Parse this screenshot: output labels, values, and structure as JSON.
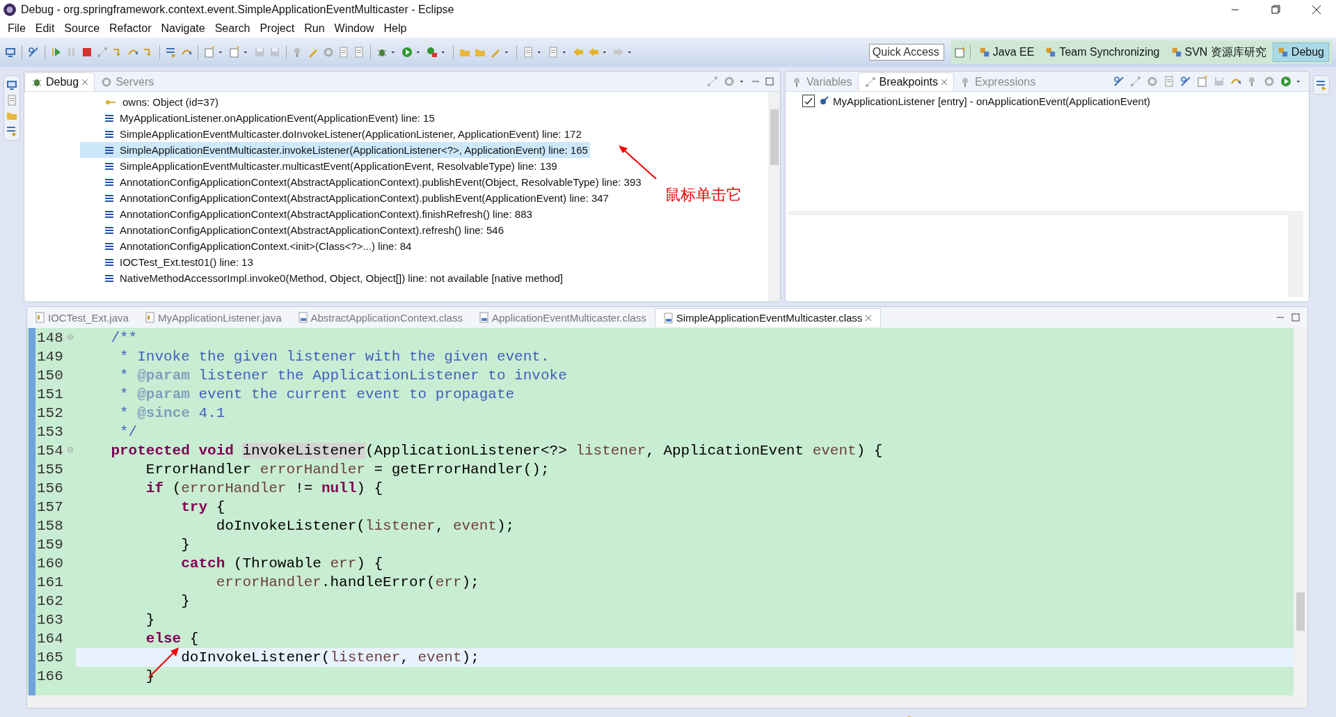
{
  "window": {
    "title": "Debug - org.springframework.context.event.SimpleApplicationEventMulticaster - Eclipse"
  },
  "menu": [
    "File",
    "Edit",
    "Source",
    "Refactor",
    "Navigate",
    "Search",
    "Project",
    "Run",
    "Window",
    "Help"
  ],
  "quick_access": {
    "placeholder": "Quick Access"
  },
  "perspectives": [
    {
      "label": "Java EE",
      "selected": false
    },
    {
      "label": "Team Synchronizing",
      "selected": false
    },
    {
      "label": "SVN 资源库研究",
      "selected": false
    },
    {
      "label": "Debug",
      "selected": true
    }
  ],
  "debug_view": {
    "tabs": [
      {
        "label": "Debug",
        "selected": true
      },
      {
        "label": "Servers",
        "selected": false
      }
    ],
    "frames": [
      {
        "kind": "variable",
        "text": "owns: Object  (id=37)",
        "selected": false
      },
      {
        "kind": "frame",
        "text": "MyApplicationListener.onApplicationEvent(ApplicationEvent) line: 15",
        "selected": false
      },
      {
        "kind": "frame",
        "text": "SimpleApplicationEventMulticaster.doInvokeListener(ApplicationListener, ApplicationEvent) line: 172",
        "selected": false
      },
      {
        "kind": "frame",
        "text": "SimpleApplicationEventMulticaster.invokeListener(ApplicationListener<?>, ApplicationEvent) line: 165",
        "selected": true
      },
      {
        "kind": "frame",
        "text": "SimpleApplicationEventMulticaster.multicastEvent(ApplicationEvent, ResolvableType) line: 139",
        "selected": false
      },
      {
        "kind": "frame",
        "text": "AnnotationConfigApplicationContext(AbstractApplicationContext).publishEvent(Object, ResolvableType) line: 393",
        "selected": false
      },
      {
        "kind": "frame",
        "text": "AnnotationConfigApplicationContext(AbstractApplicationContext).publishEvent(ApplicationEvent) line: 347",
        "selected": false
      },
      {
        "kind": "frame",
        "text": "AnnotationConfigApplicationContext(AbstractApplicationContext).finishRefresh() line: 883",
        "selected": false
      },
      {
        "kind": "frame",
        "text": "AnnotationConfigApplicationContext(AbstractApplicationContext).refresh() line: 546",
        "selected": false
      },
      {
        "kind": "frame",
        "text": "AnnotationConfigApplicationContext.<init>(Class<?>...) line: 84",
        "selected": false
      },
      {
        "kind": "frame",
        "text": "IOCTest_Ext.test01() line: 13",
        "selected": false
      },
      {
        "kind": "frame",
        "text": "NativeMethodAccessorImpl.invoke0(Method, Object, Object[]) line: not available [native method]",
        "selected": false
      }
    ]
  },
  "breakpoints_view": {
    "tabs": [
      {
        "label": "Variables",
        "selected": false
      },
      {
        "label": "Breakpoints",
        "selected": true
      },
      {
        "label": "Expressions",
        "selected": false
      }
    ],
    "breakpoints": [
      {
        "text": "MyApplicationListener [entry] - onApplicationEvent(ApplicationEvent)",
        "checked": true
      }
    ]
  },
  "editor": {
    "tabs": [
      {
        "label": "IOCTest_Ext.java",
        "kind": "java",
        "selected": false
      },
      {
        "label": "MyApplicationListener.java",
        "kind": "java",
        "selected": false
      },
      {
        "label": "AbstractApplicationContext.class",
        "kind": "class",
        "selected": false
      },
      {
        "label": "ApplicationEventMulticaster.class",
        "kind": "class",
        "selected": false
      },
      {
        "label": "SimpleApplicationEventMulticaster.class",
        "kind": "class",
        "selected": true
      }
    ],
    "lines": [
      {
        "number": "148",
        "fold": true,
        "current": false,
        "tokens": [
          {
            "kind": "comment",
            "text": "    /**"
          }
        ]
      },
      {
        "number": "149",
        "fold": false,
        "current": false,
        "tokens": [
          {
            "kind": "comment",
            "text": "     * Invoke the given listener with the given event."
          }
        ]
      },
      {
        "number": "150",
        "fold": false,
        "current": false,
        "tokens": [
          {
            "kind": "comment",
            "text": "     * "
          },
          {
            "kind": "tag",
            "text": "@param"
          },
          {
            "kind": "comment",
            "text": " listener the ApplicationListener to invoke"
          }
        ]
      },
      {
        "number": "151",
        "fold": false,
        "current": false,
        "tokens": [
          {
            "kind": "comment",
            "text": "     * "
          },
          {
            "kind": "tag",
            "text": "@param"
          },
          {
            "kind": "comment",
            "text": " event the current event to propagate"
          }
        ]
      },
      {
        "number": "152",
        "fold": false,
        "current": false,
        "tokens": [
          {
            "kind": "comment",
            "text": "     * "
          },
          {
            "kind": "tag",
            "text": "@since"
          },
          {
            "kind": "comment",
            "text": " 4.1"
          }
        ]
      },
      {
        "number": "153",
        "fold": false,
        "current": false,
        "tokens": [
          {
            "kind": "comment",
            "text": "     */"
          }
        ]
      },
      {
        "number": "154",
        "fold": true,
        "current": false,
        "tokens": [
          {
            "kind": "keyword",
            "text": "    protected void "
          },
          {
            "kind": "occurrence",
            "text": "invokeListener"
          },
          {
            "kind": "plain",
            "text": "(ApplicationListener<?> "
          },
          {
            "kind": "variable",
            "text": "listener"
          },
          {
            "kind": "plain",
            "text": ", ApplicationEvent "
          },
          {
            "kind": "variable",
            "text": "event"
          },
          {
            "kind": "plain",
            "text": ") {"
          }
        ]
      },
      {
        "number": "155",
        "fold": false,
        "current": false,
        "tokens": [
          {
            "kind": "plain",
            "text": "        ErrorHandler "
          },
          {
            "kind": "variable",
            "text": "errorHandler"
          },
          {
            "kind": "plain",
            "text": " = getErrorHandler();"
          }
        ]
      },
      {
        "number": "156",
        "fold": false,
        "current": false,
        "tokens": [
          {
            "kind": "keyword",
            "text": "        if"
          },
          {
            "kind": "plain",
            "text": " ("
          },
          {
            "kind": "variable",
            "text": "errorHandler"
          },
          {
            "kind": "plain",
            "text": " != "
          },
          {
            "kind": "keyword",
            "text": "null"
          },
          {
            "kind": "plain",
            "text": ") {"
          }
        ]
      },
      {
        "number": "157",
        "fold": false,
        "current": false,
        "tokens": [
          {
            "kind": "keyword",
            "text": "            try"
          },
          {
            "kind": "plain",
            "text": " {"
          }
        ]
      },
      {
        "number": "158",
        "fold": false,
        "current": false,
        "tokens": [
          {
            "kind": "plain",
            "text": "                doInvokeListener("
          },
          {
            "kind": "variable",
            "text": "listener"
          },
          {
            "kind": "plain",
            "text": ", "
          },
          {
            "kind": "variable",
            "text": "event"
          },
          {
            "kind": "plain",
            "text": ");"
          }
        ]
      },
      {
        "number": "159",
        "fold": false,
        "current": false,
        "tokens": [
          {
            "kind": "plain",
            "text": "            }"
          }
        ]
      },
      {
        "number": "160",
        "fold": false,
        "current": false,
        "tokens": [
          {
            "kind": "keyword",
            "text": "            catch"
          },
          {
            "kind": "plain",
            "text": " (Throwable "
          },
          {
            "kind": "variable",
            "text": "err"
          },
          {
            "kind": "plain",
            "text": ") {"
          }
        ]
      },
      {
        "number": "161",
        "fold": false,
        "current": false,
        "tokens": [
          {
            "kind": "variable",
            "text": "                errorHandler"
          },
          {
            "kind": "plain",
            "text": ".handleError("
          },
          {
            "kind": "variable",
            "text": "err"
          },
          {
            "kind": "plain",
            "text": ");"
          }
        ]
      },
      {
        "number": "162",
        "fold": false,
        "current": false,
        "tokens": [
          {
            "kind": "plain",
            "text": "            }"
          }
        ]
      },
      {
        "number": "163",
        "fold": false,
        "current": false,
        "tokens": [
          {
            "kind": "plain",
            "text": "        }"
          }
        ]
      },
      {
        "number": "164",
        "fold": false,
        "current": false,
        "tokens": [
          {
            "kind": "keyword",
            "text": "        else"
          },
          {
            "kind": "plain",
            "text": " {"
          }
        ]
      },
      {
        "number": "165",
        "fold": false,
        "current": true,
        "tokens": [
          {
            "kind": "plain",
            "text": "            doInvokeListener("
          },
          {
            "kind": "variable",
            "text": "listener"
          },
          {
            "kind": "plain",
            "text": ", "
          },
          {
            "kind": "variable",
            "text": "event"
          },
          {
            "kind": "plain",
            "text": ");"
          }
        ]
      },
      {
        "number": "166",
        "fold": false,
        "current": false,
        "tokens": [
          {
            "kind": "plain",
            "text": "        }"
          }
        ]
      }
    ]
  },
  "annotations": [
    {
      "text": "鼠标单击它"
    }
  ]
}
